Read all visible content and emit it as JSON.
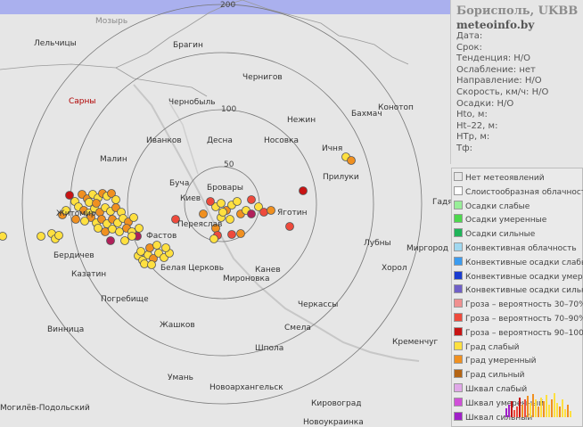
{
  "header": {
    "title": "Борисполь, UKBB",
    "site": "meteoinfo.by"
  },
  "info_fields": [
    {
      "label": "Дата:",
      "value": ""
    },
    {
      "label": "Срок:",
      "value": ""
    },
    {
      "label": "Тенденция:",
      "value": "Н/О"
    },
    {
      "label": "Ослабление:",
      "value": "нет"
    },
    {
      "label": "Направление:",
      "value": "Н/О"
    },
    {
      "label": "Скорость, км/ч:",
      "value": "Н/О"
    },
    {
      "label": "Осадки:",
      "value": "Н/О"
    },
    {
      "label": "Hto, м:",
      "value": ""
    },
    {
      "label": "Ht–22, м:",
      "value": ""
    },
    {
      "label": "HTp, м:",
      "value": ""
    },
    {
      "label": "Tф:",
      "value": ""
    }
  ],
  "range_rings": [
    {
      "label": "50",
      "radius_km": 50
    },
    {
      "label": "100",
      "radius_km": 100
    },
    {
      "label": "200",
      "radius_km": 200
    }
  ],
  "cities": [
    {
      "name": "Мозырь",
      "style": "gray"
    },
    {
      "name": "Брагин",
      "style": "normal"
    },
    {
      "name": "Лельчицы",
      "style": "normal"
    },
    {
      "name": "Чернигов",
      "style": "normal"
    },
    {
      "name": "Чернобыль",
      "style": "normal"
    },
    {
      "name": "Сарны",
      "style": "normal"
    },
    {
      "name": "Бахмач",
      "style": "normal"
    },
    {
      "name": "Конотоп",
      "style": "normal"
    },
    {
      "name": "Нежин",
      "style": "normal"
    },
    {
      "name": "Иванков",
      "style": "normal"
    },
    {
      "name": "Десна",
      "style": "normal"
    },
    {
      "name": "Носовка",
      "style": "normal"
    },
    {
      "name": "Ичня",
      "style": "normal"
    },
    {
      "name": "Малин",
      "style": "normal"
    },
    {
      "name": "Прилуки",
      "style": "normal"
    },
    {
      "name": "Буча",
      "style": "normal"
    },
    {
      "name": "Бровары",
      "style": "normal"
    },
    {
      "name": "Киев",
      "style": "normal"
    },
    {
      "name": "Житомир",
      "style": "normal"
    },
    {
      "name": "Яготин",
      "style": "normal"
    },
    {
      "name": "Гадяч",
      "style": "normal"
    },
    {
      "name": "Фастов",
      "style": "normal"
    },
    {
      "name": "Переяслав",
      "style": "normal"
    },
    {
      "name": "Лубны",
      "style": "normal"
    },
    {
      "name": "Миргород",
      "style": "normal"
    },
    {
      "name": "Бердичев",
      "style": "normal"
    },
    {
      "name": "Белая Церковь",
      "style": "normal"
    },
    {
      "name": "Канев",
      "style": "normal"
    },
    {
      "name": "Хорол",
      "style": "normal"
    },
    {
      "name": "Казатин",
      "style": "normal"
    },
    {
      "name": "Мироновка",
      "style": "normal"
    },
    {
      "name": "Погребище",
      "style": "normal"
    },
    {
      "name": "Черкассы",
      "style": "normal"
    },
    {
      "name": "Винница",
      "style": "normal"
    },
    {
      "name": "Жашков",
      "style": "normal"
    },
    {
      "name": "Смела",
      "style": "normal"
    },
    {
      "name": "Кременчуг",
      "style": "normal"
    },
    {
      "name": "Шпола",
      "style": "normal"
    },
    {
      "name": "Умань",
      "style": "normal"
    },
    {
      "name": "Новоархангельск",
      "style": "normal"
    },
    {
      "name": "Могилёв-Подольский",
      "style": "normal"
    },
    {
      "name": "Кировоград",
      "style": "normal"
    },
    {
      "name": "Новоукраинка",
      "style": "normal"
    }
  ],
  "legend": [
    {
      "label": "Нет метеоявлений",
      "color": "#e6e6e6"
    },
    {
      "label": "Слоистообразная облачность",
      "color": "#ffffff"
    },
    {
      "label": "Осадки слабые",
      "color": "#98ee98"
    },
    {
      "label": "Осадки умеренные",
      "color": "#4dd84d"
    },
    {
      "label": "Осадки сильные",
      "color": "#20b45a"
    },
    {
      "label": "Конвективная облачность",
      "color": "#a0d8f0"
    },
    {
      "label": "Конвективные осадки слабые",
      "color": "#3c9cf0"
    },
    {
      "label": "Конвективные осадки умерен.",
      "color": "#1a3cd0"
    },
    {
      "label": "Конвективные осадки сильные",
      "color": "#7060c8"
    },
    {
      "label": "Гроза – вероятность 30–70%",
      "color": "#f09090"
    },
    {
      "label": "Гроза – вероятность 70–90%",
      "color": "#ee4a3c"
    },
    {
      "label": "Гроза – вероятность 90–100%",
      "color": "#c81414"
    },
    {
      "label": "Град слабый",
      "color": "#ffe040"
    },
    {
      "label": "Град умеренный",
      "color": "#f09020"
    },
    {
      "label": "Град сильный",
      "color": "#b46414"
    },
    {
      "label": "Шквал слабый",
      "color": "#e0a8e8"
    },
    {
      "label": "Шквал умеренный",
      "color": "#d050d8"
    },
    {
      "label": "Шквал сильный",
      "color": "#a020c8"
    }
  ],
  "colors": {
    "ring": "#777777",
    "map_bg": "#e6e6e6",
    "top_band": "#aab0ee"
  }
}
